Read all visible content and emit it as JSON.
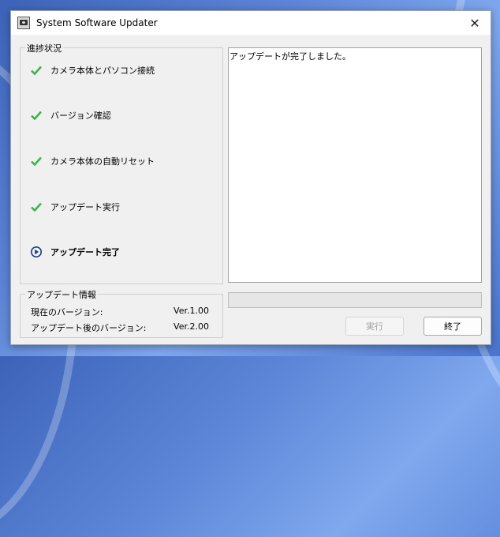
{
  "window": {
    "title": "System Software Updater",
    "close_glyph": "✕"
  },
  "progress": {
    "title": "進捗状況",
    "steps": [
      {
        "label": "カメラ本体とパソコン接続",
        "status": "done"
      },
      {
        "label": "バージョン確認",
        "status": "done"
      },
      {
        "label": "カメラ本体の自動リセット",
        "status": "done"
      },
      {
        "label": "アップデート実行",
        "status": "done"
      },
      {
        "label": "アップデート完了",
        "status": "current"
      }
    ]
  },
  "info": {
    "title": "アップデート情報",
    "current_label": "現在のバージョン:",
    "current_value": "Ver.1.00",
    "after_label": "アップデート後のバージョン:",
    "after_value": "Ver.2.00"
  },
  "log": {
    "text": "アップデートが完了しました。"
  },
  "progress_bar": {
    "fraction": 0
  },
  "buttons": {
    "run": "実行",
    "end": "終了"
  },
  "colors": {
    "check": "#3fb549",
    "current_step": "#1a3a86",
    "accent_fill": "#06b025"
  }
}
